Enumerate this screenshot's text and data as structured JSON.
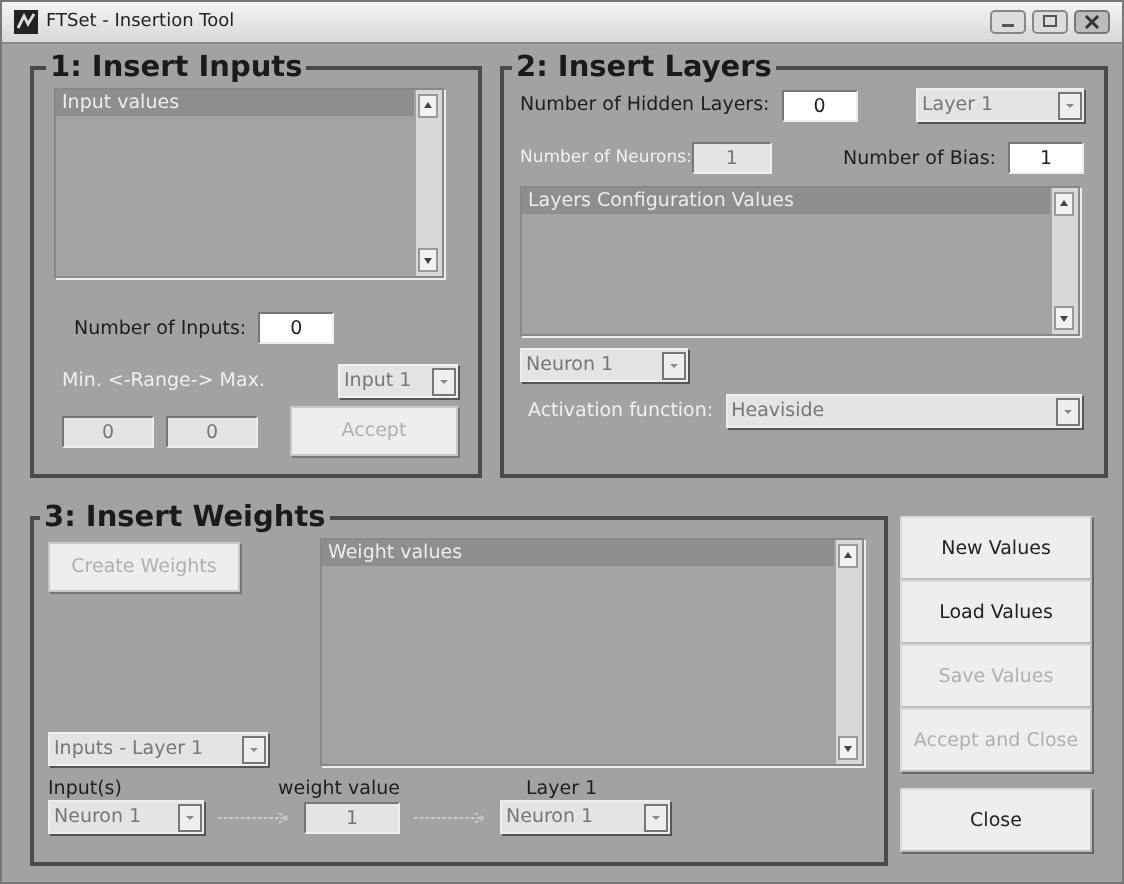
{
  "window": {
    "title": "FTSet - Insertion Tool"
  },
  "inputs_panel": {
    "title": "1: Insert Inputs",
    "list_header": "Input values",
    "count_label": {
      "text": "Number of Inputs:",
      "disabled": false
    },
    "count_field": {
      "value": "0",
      "disabled": false
    },
    "range_label": {
      "text": "Min. <-Range-> Max.",
      "disabled": true
    },
    "input_select": {
      "value": "Input 1",
      "disabled": true
    },
    "min_field": {
      "value": "0",
      "disabled": true
    },
    "max_field": {
      "value": "0",
      "disabled": true
    },
    "accept_button": {
      "label": "Accept",
      "disabled": true
    }
  },
  "layers_panel": {
    "title": "2: Insert Layers",
    "hidden_label": {
      "text": "Number of Hidden Layers:",
      "disabled": false
    },
    "hidden_field": {
      "value": "0",
      "disabled": false
    },
    "layer_select": {
      "value": "Layer 1",
      "disabled": true
    },
    "neurons_label": {
      "text": "Number of Neurons:",
      "disabled": true
    },
    "neurons_field": {
      "value": "1",
      "disabled": true
    },
    "bias_label": {
      "text": "Number of Bias:",
      "disabled": false
    },
    "bias_field": {
      "value": "1",
      "disabled": false
    },
    "list_header": "Layers Configuration Values",
    "neuron_select": {
      "value": "Neuron 1",
      "disabled": true
    },
    "activation_label": {
      "text": "Activation function:",
      "disabled": true
    },
    "activation_select": {
      "value": "Heaviside",
      "disabled": true
    }
  },
  "weights_panel": {
    "title": "3: Insert Weights",
    "create_button": {
      "label": "Create Weights",
      "disabled": true
    },
    "list_header": "Weight values",
    "pair_select": {
      "value": "Inputs - Layer 1",
      "disabled": true
    },
    "from_label": "Input(s)",
    "weight_label": "weight value",
    "to_label": "Layer 1",
    "from_select": {
      "value": "Neuron 1",
      "disabled": true
    },
    "weight_field": {
      "value": "1",
      "disabled": true
    },
    "to_select": {
      "value": "Neuron 1",
      "disabled": true
    }
  },
  "action_buttons": [
    {
      "label": "New Values",
      "disabled": false
    },
    {
      "label": "Load Values",
      "disabled": false
    },
    {
      "label": "Save Values",
      "disabled": true
    },
    {
      "label": "Accept and Close",
      "disabled": true
    }
  ],
  "close_button": {
    "label": "Close",
    "disabled": false
  }
}
